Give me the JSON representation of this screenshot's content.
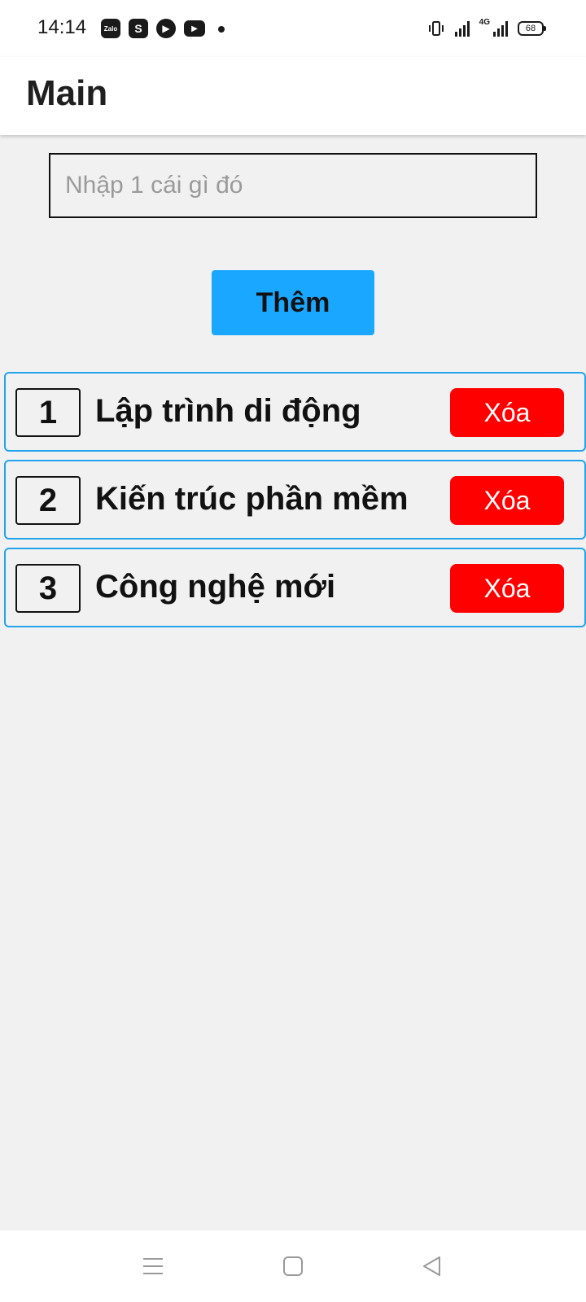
{
  "status_bar": {
    "time": "14:14",
    "apps": [
      {
        "name": "zalo-icon",
        "label": "Zalo"
      },
      {
        "name": "shopee-icon",
        "label": "S"
      },
      {
        "name": "play-icon",
        "label": "▶"
      },
      {
        "name": "youtube-icon",
        "label": "▶"
      }
    ],
    "network": "4G",
    "battery": "68"
  },
  "header": {
    "title": "Main"
  },
  "form": {
    "input_value": "",
    "input_placeholder": "Nhập 1 cái gì đó",
    "add_label": "Thêm"
  },
  "items": [
    {
      "number": "1",
      "title": "Lập trình di động",
      "delete_label": "Xóa"
    },
    {
      "number": "2",
      "title": "Kiến trúc phần mềm",
      "delete_label": "Xóa"
    },
    {
      "number": "3",
      "title": "Công nghệ mới",
      "delete_label": "Xóa"
    }
  ],
  "colors": {
    "accent": "#1aa7ff",
    "item_border": "#22a3ec",
    "delete": "#ff0000",
    "background": "#f1f1f1"
  },
  "nav": {
    "icons": [
      "menu-icon",
      "home-icon",
      "back-icon"
    ]
  }
}
